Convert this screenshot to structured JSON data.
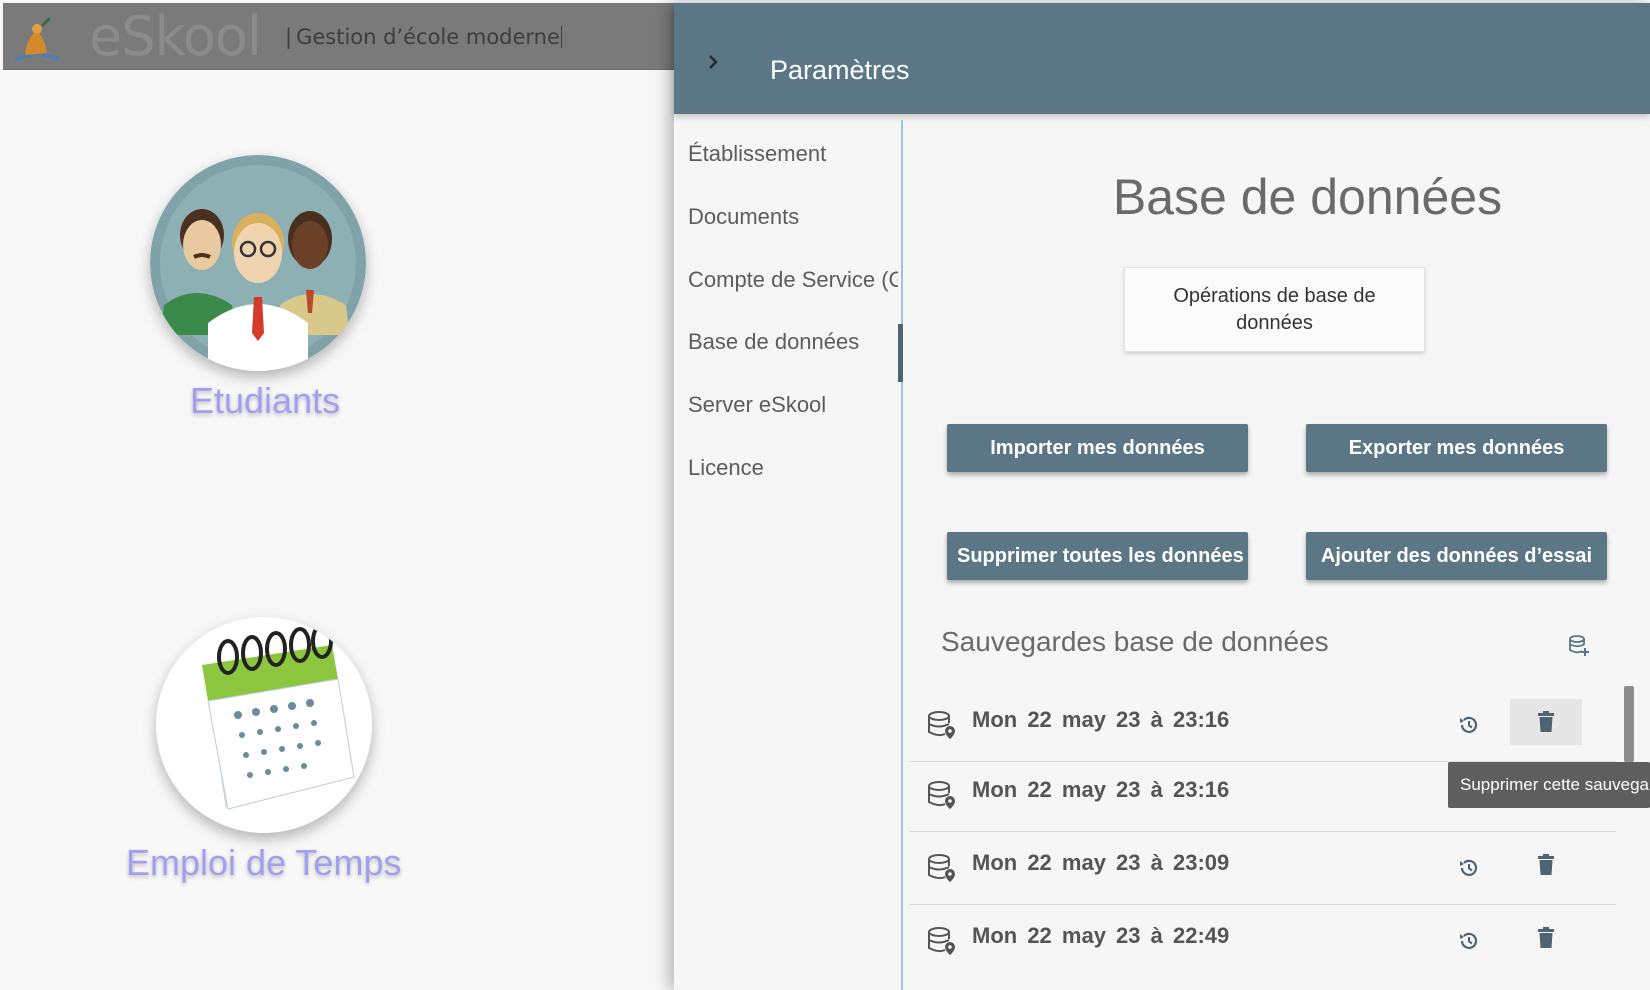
{
  "app": {
    "brand": "eSkool",
    "subtitle_sep": "|",
    "subtitle": "Gestion d’école moderne",
    "tiles": [
      {
        "label": "Etudiants",
        "icon": "students-icon"
      },
      {
        "label": "Emploi de Temps",
        "icon": "calendar-icon"
      }
    ]
  },
  "panel": {
    "title": "Paramètres",
    "nav": [
      {
        "label": "Établissement"
      },
      {
        "label": "Documents"
      },
      {
        "label": "Compte de Service (Gmail)"
      },
      {
        "label": "Base de données",
        "active": true
      },
      {
        "label": "Server eSkool"
      },
      {
        "label": "Licence"
      }
    ],
    "section_title": "Base de données",
    "ops_card": {
      "line1": "Opérations de base de",
      "line2": "données"
    },
    "buttons": {
      "import": "Importer mes données",
      "export": "Exporter mes données",
      "delete_all": "Supprimer toutes les données",
      "add_test": "Ajouter des données d’essai"
    },
    "backups_title": "Sauvegardes base de données",
    "backups": [
      {
        "date": "Mon 22 may 23  à  23:16"
      },
      {
        "date": "Mon 22 may 23  à  23:16"
      },
      {
        "date": "Mon 22 may 23  à  23:09"
      },
      {
        "date": "Mon 22 may 23  à  22:49"
      }
    ],
    "tooltip": "Supprimer cette sauvegarde"
  },
  "colors": {
    "header": "#5b7685",
    "button": "#5b7685",
    "tile_label": "#a39ff0",
    "accent_line": "#9cc5d6"
  }
}
